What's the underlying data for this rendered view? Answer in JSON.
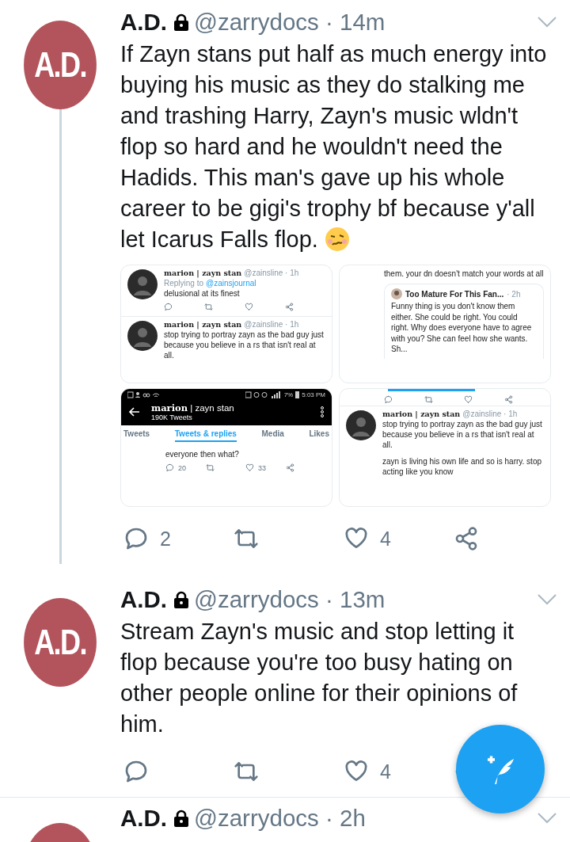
{
  "tweets": [
    {
      "avatar_text": "A.D.",
      "name": "A.D.",
      "locked": true,
      "meta": "@zarrydocs · 14m",
      "thread": true,
      "body": "If Zayn stans put half as much energy into buying his music as they do stalking me and trashing Harry, Zayn's music wldn't flop so hard and he wouldn't need the Hadids. This man's gave up his whole career to be gigi's trophy bf because y'all let Icarus Falls flop.",
      "emoji": true,
      "media": [
        {
          "kind": "tweets",
          "items": [
            {
              "name": "marion | zayn stan",
              "meta": "@zainsline · 1h",
              "reply_prefix": "Replying to",
              "reply_to": "@zainsjournal",
              "text": "delusional at its finest",
              "actions": true
            },
            {
              "name": "marion | zayn stan",
              "meta": "@zainsline · 1h",
              "text": "stop trying to portray zayn as the bad guy just because you believe in a rs that isn't real at all."
            }
          ]
        },
        {
          "kind": "quote",
          "text": "them. your dn doesn't match your words at all",
          "quote": {
            "name": "Too Mature For This Fan...",
            "time": "· 2h",
            "text": "Funny thing is you don't know them either. She could be right. You could right. Why does everyone have to agree with you? She can feel how she wants. Sh..."
          }
        },
        {
          "kind": "profile",
          "battery": "7%",
          "clock": "5:03 PM",
          "title": "**marion** | zayn stan",
          "count": "190K Tweets",
          "tabs": [
            {
              "label": "Tweets",
              "selected": false
            },
            {
              "label": "Tweets & replies",
              "selected": true
            },
            {
              "label": "Media",
              "selected": false
            },
            {
              "label": "Likes",
              "selected": false
            }
          ],
          "snippet": "everyone then what?",
          "replies": "20",
          "likes": "33"
        },
        {
          "kind": "tweets",
          "items": [
            {
              "actions_only": true
            },
            {
              "name": "marion | zayn stan",
              "meta": "@zainsline · 1h",
              "text": "stop trying to portray zayn as the bad guy just because you believe in a rs that isn't real at all.",
              "text2": "zayn is living his own life and so is harry. stop acting like you know"
            }
          ]
        }
      ],
      "replies": "2",
      "likes": "4"
    },
    {
      "avatar_text": "A.D.",
      "name": "A.D.",
      "locked": true,
      "meta": "@zarrydocs · 13m",
      "thread": false,
      "body": "Stream Zayn's music and stop letting it flop because you're too busy hating on other people online for their opinions of him.",
      "emoji": false,
      "likes": "4"
    },
    {
      "name": "A.D.",
      "locked": true,
      "meta": "@zarrydocs · 2h",
      "thread": false
    }
  ]
}
